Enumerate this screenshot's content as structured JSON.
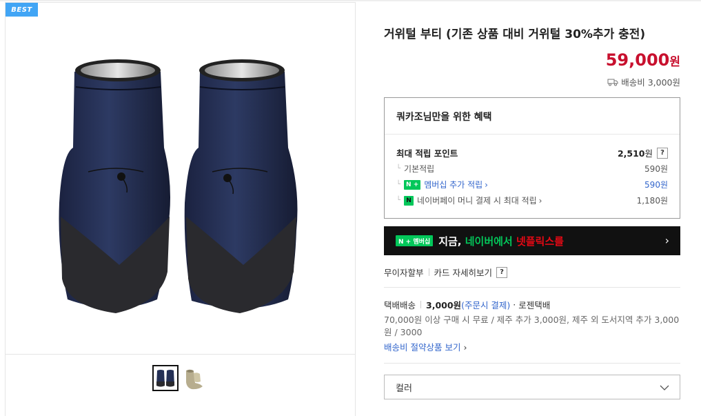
{
  "image_panel": {
    "badge": "BEST",
    "thumbnails": [
      {
        "icon": "navy-boots-thumbnail",
        "active": true
      },
      {
        "icon": "beige-boots-thumbnail",
        "active": false
      }
    ]
  },
  "product": {
    "title": "거위털 부티 (기존 상품 대비 거위털 30%추가 충전)",
    "price": "59,000",
    "price_unit": "원",
    "shipping_fee": "배송비 3,000원",
    "shipping_icon": "truck-icon"
  },
  "benefits": {
    "title": "쿼카조님만을 위한 혜택",
    "max_points_label": "최대 적립 포인트",
    "max_points_value": "2,510",
    "max_points_unit": "원",
    "help": "?",
    "rows": [
      {
        "label": "기본적립",
        "value": "590원"
      },
      {
        "badge": "N +",
        "label": "멤버십 추가 적립",
        "value": "590원"
      },
      {
        "badge": "N",
        "label": "네이버페이 머니 결제 시 최대 적립",
        "value": "1,180원"
      }
    ]
  },
  "promo": {
    "badge": "N + 멤버십",
    "text_1": "지금, ",
    "text_2": "네이버에서 ",
    "text_3": "넷플릭스를"
  },
  "payment": {
    "installment": "무이자할부",
    "card_details": "카드 자세히보기",
    "help": "?"
  },
  "delivery": {
    "method": "택배배송",
    "price": "3,000원",
    "pay_note": "(주문시 결제)",
    "dot": "·",
    "courier": "로젠택배",
    "description": "70,000원 이상 구매 시 무료 / 제주 추가 3,000원, 제주 외 도서지역 추가 3,000원 / 3000",
    "save_link": "배송비 절약상품 보기"
  },
  "options": {
    "color_label": "컬러"
  },
  "colors": {
    "price_red": "#c8102e",
    "naver_green": "#03c75a",
    "link_blue": "#3366cc",
    "best_blue": "#41a5f5"
  }
}
